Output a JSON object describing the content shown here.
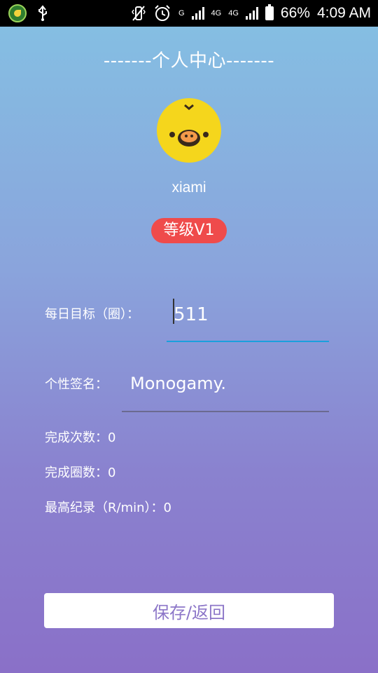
{
  "status_bar": {
    "network_label_1": "G",
    "network_label_2": "4G",
    "network_label_3": "4G",
    "battery_percent": "66%",
    "time": "4:09 AM",
    "icons": [
      "music-app-icon",
      "usb-icon",
      "vibrate-icon",
      "alarm-icon",
      "signal-icon",
      "battery-icon"
    ]
  },
  "header": {
    "title": "-------个人中心-------"
  },
  "profile": {
    "avatar_icon": "chick-avatar-icon",
    "username": "xiami",
    "level": "等级V1"
  },
  "form": {
    "goal_label": "每日目标（圈）：",
    "goal_value": "511",
    "signature_label": "个性签名：",
    "signature_value": "Monogamy."
  },
  "stats": {
    "completed_times": "完成次数：0",
    "completed_laps": "完成圈数：0",
    "best_record": "最高纪录（R/min）：0"
  },
  "actions": {
    "save_label": "保存/返回"
  },
  "colors": {
    "accent_badge": "#ef4b4b",
    "input_focus_line": "#1aa0dd",
    "button_text": "#8c76c8",
    "avatar": "#f5d61c"
  }
}
